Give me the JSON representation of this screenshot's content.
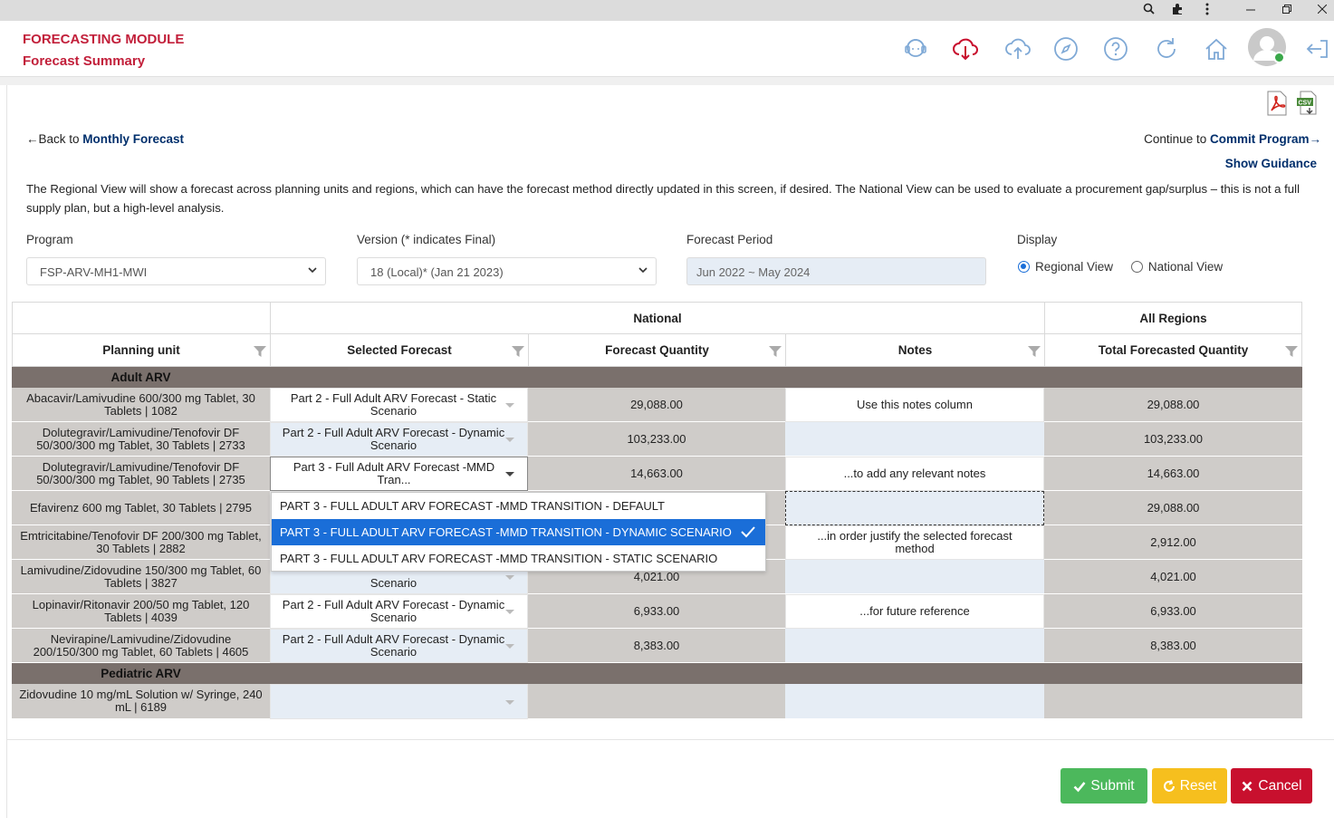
{
  "header": {
    "module_title": "FORECASTING MODULE",
    "page_title": "Forecast Summary"
  },
  "nav": {
    "back_prefix": "←Back to ",
    "back_link": "Monthly Forecast",
    "continue_prefix": "Continue to ",
    "continue_link": "Commit Program→",
    "guidance": "Show Guidance"
  },
  "description": "The Regional View will show a forecast across planning units and regions, which can have the forecast method directly updated in this screen, if desired. The National View can be used to evaluate a procurement gap/surplus – this is not a full supply plan, but a high-level analysis.",
  "filters": {
    "program_label": "Program",
    "program_value": "FSP-ARV-MH1-MWI",
    "version_label": "Version (* indicates Final)",
    "version_value": "18 (Local)* (Jan 21 2023)",
    "period_label": "Forecast Period",
    "period_value": "Jun 2022 ~ May 2024",
    "display_label": "Display",
    "display_options": [
      "Regional View",
      "National View"
    ],
    "display_selected": "Regional View"
  },
  "table": {
    "group_headers": {
      "national": "National",
      "all_regions": "All Regions"
    },
    "columns": [
      "Planning unit",
      "Selected Forecast",
      "Forecast Quantity",
      "Notes",
      "Total Forecasted Quantity"
    ],
    "groups": [
      {
        "name": "Adult ARV",
        "rows": [
          {
            "planning_unit": "Abacavir/Lamivudine 600/300 mg Tablet, 30 Tablets | 1082",
            "selected_forecast": "Part 2 - Full Adult ARV Forecast - Static Scenario",
            "forecast_quantity": "29,088.00",
            "notes": "Use this notes column",
            "total": "29,088.00"
          },
          {
            "planning_unit": "Dolutegravir/Lamivudine/Tenofovir DF 50/300/300 mg Tablet, 30 Tablets | 2733",
            "selected_forecast": "Part 2 - Full Adult ARV Forecast - Dynamic Scenario",
            "forecast_quantity": "103,233.00",
            "notes": "",
            "total": "103,233.00"
          },
          {
            "planning_unit": "Dolutegravir/Lamivudine/Tenofovir DF 50/300/300 mg Tablet, 90 Tablets | 2735",
            "selected_forecast": "Part 3 - Full Adult ARV Forecast -MMD Tran...",
            "forecast_quantity": "14,663.00",
            "notes": "...to add any relevant notes",
            "total": "14,663.00"
          },
          {
            "planning_unit": "Efavirenz 600 mg Tablet, 30 Tablets | 2795",
            "selected_forecast": "",
            "forecast_quantity": "",
            "notes": "",
            "total": "29,088.00"
          },
          {
            "planning_unit": "Emtricitabine/Tenofovir DF 200/300 mg Tablet, 30 Tablets | 2882",
            "selected_forecast": "",
            "forecast_quantity": "",
            "notes": "...in order justify the selected forecast method",
            "total": "2,912.00"
          },
          {
            "planning_unit": "Lamivudine/Zidovudine 150/300 mg Tablet, 60 Tablets | 3827",
            "selected_forecast": "Scenario",
            "forecast_quantity": "4,021.00",
            "notes": "",
            "total": "4,021.00"
          },
          {
            "planning_unit": "Lopinavir/Ritonavir 200/50 mg Tablet, 120 Tablets | 4039",
            "selected_forecast": "Part 2 - Full Adult ARV Forecast - Dynamic Scenario",
            "forecast_quantity": "6,933.00",
            "notes": "...for future reference",
            "total": "6,933.00"
          },
          {
            "planning_unit": "Nevirapine/Lamivudine/Zidovudine 200/150/300 mg Tablet, 60 Tablets | 4605",
            "selected_forecast": "Part 2 - Full Adult ARV Forecast - Dynamic Scenario",
            "forecast_quantity": "8,383.00",
            "notes": "",
            "total": "8,383.00"
          }
        ]
      },
      {
        "name": "Pediatric ARV",
        "rows": [
          {
            "planning_unit": "Zidovudine 10 mg/mL Solution w/ Syringe, 240 mL | 6189",
            "selected_forecast": "",
            "forecast_quantity": "",
            "notes": "",
            "total": ""
          }
        ]
      }
    ]
  },
  "dropdown": {
    "options": [
      "PART 3 - FULL ADULT ARV FORECAST -MMD TRANSITION - DEFAULT",
      "PART 3 - FULL ADULT ARV FORECAST -MMD TRANSITION - DYNAMIC SCENARIO",
      "PART 3 - FULL ADULT ARV FORECAST -MMD TRANSITION - STATIC SCENARIO"
    ],
    "selected_index": 1
  },
  "buttons": {
    "submit": "Submit",
    "reset": "Reset",
    "cancel": "Cancel"
  },
  "colors": {
    "brand_red": "#c21f3a",
    "link_navy": "#002f6c",
    "submit_green": "#4cb85c",
    "reset_yellow": "#f6bf1e",
    "cancel_red": "#c8102e",
    "selection_blue": "#1a6ed8"
  }
}
